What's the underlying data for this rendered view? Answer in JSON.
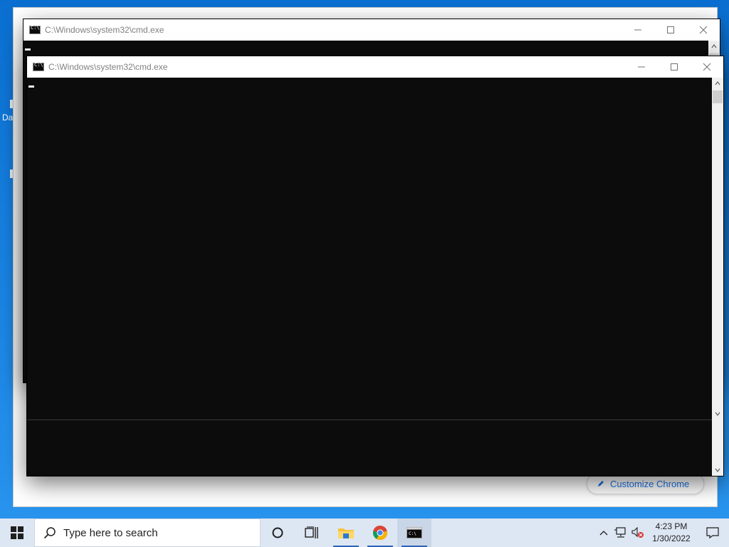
{
  "desktop": {
    "icon_fragment_label": "Da"
  },
  "chrome": {
    "customize_label": "Customize Chrome"
  },
  "cmd_back": {
    "title": "C:\\Windows\\system32\\cmd.exe",
    "minimize_icon": "minimize-icon",
    "maximize_icon": "maximize-icon",
    "close_icon": "close-icon"
  },
  "cmd_front": {
    "title": "C:\\Windows\\system32\\cmd.exe",
    "minimize_icon": "minimize-icon",
    "maximize_icon": "maximize-icon",
    "close_icon": "close-icon"
  },
  "taskbar": {
    "search_placeholder": "Type here to search",
    "pinned": [
      {
        "name": "cortana",
        "icon": "cortana-circle-icon"
      },
      {
        "name": "task-view",
        "icon": "task-view-icon"
      },
      {
        "name": "file-explorer",
        "icon": "folder-icon"
      },
      {
        "name": "chrome",
        "icon": "chrome-icon"
      },
      {
        "name": "cmd",
        "icon": "terminal-icon"
      }
    ],
    "tray": {
      "time": "4:23 PM",
      "date": "1/30/2022"
    }
  },
  "colors": {
    "desktop_blue": "#1b86e6",
    "taskbar_bg": "#dde6f3",
    "console_bg": "#0c0c0c",
    "chrome_accent": "#1a73e8"
  }
}
